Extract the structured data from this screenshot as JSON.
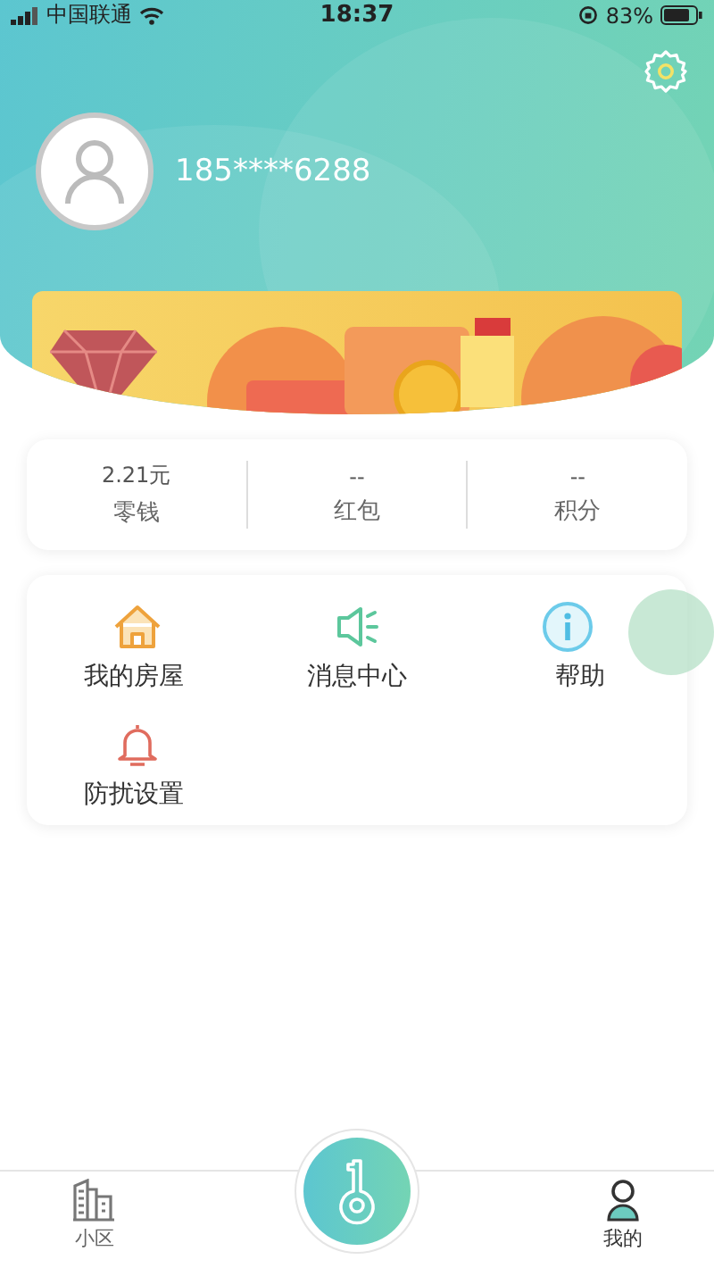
{
  "status_bar": {
    "carrier": "中国联通",
    "time": "18:37",
    "battery": "83%"
  },
  "profile": {
    "phone": "185****6288"
  },
  "stats": [
    {
      "value": "2.21元",
      "label": "零钱"
    },
    {
      "value": "--",
      "label": "红包"
    },
    {
      "value": "--",
      "label": "积分"
    }
  ],
  "menu": [
    {
      "kind": "house",
      "label": "我的房屋"
    },
    {
      "kind": "speaker",
      "label": "消息中心"
    },
    {
      "kind": "info",
      "label": "帮助"
    },
    {
      "kind": "bell",
      "label": "防扰设置"
    }
  ],
  "tab_bar": [
    {
      "kind": "building",
      "label": "小区",
      "selected": false
    },
    {
      "kind": "person",
      "label": "我的",
      "selected": true
    }
  ]
}
